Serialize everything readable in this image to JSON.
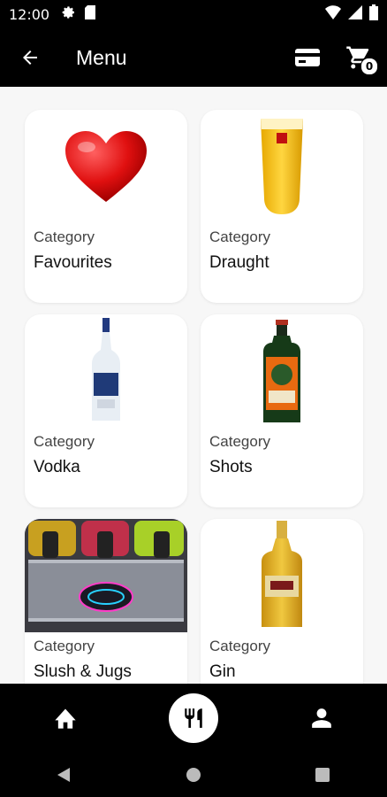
{
  "status": {
    "time": "12:00"
  },
  "appbar": {
    "title": "Menu",
    "cart_count": "0"
  },
  "categories": [
    {
      "caption": "Category",
      "name": "Favourites",
      "image": "heart-icon"
    },
    {
      "caption": "Category",
      "name": "Draught",
      "image": "beer-glass-image"
    },
    {
      "caption": "Category",
      "name": "Vodka",
      "image": "vodka-bottle-image"
    },
    {
      "caption": "Category",
      "name": "Shots",
      "image": "jager-bottle-image"
    },
    {
      "caption": "Category",
      "name": "Slush & Jugs",
      "image": "slush-machine-image"
    },
    {
      "caption": "Category",
      "name": "Gin",
      "image": "gin-bottle-image"
    }
  ],
  "bottom_nav": {
    "items": [
      "home-icon",
      "restaurant-icon",
      "person-icon"
    ]
  },
  "colors": {
    "bar": "#000000",
    "background": "#f7f7f7",
    "card": "#ffffff"
  }
}
